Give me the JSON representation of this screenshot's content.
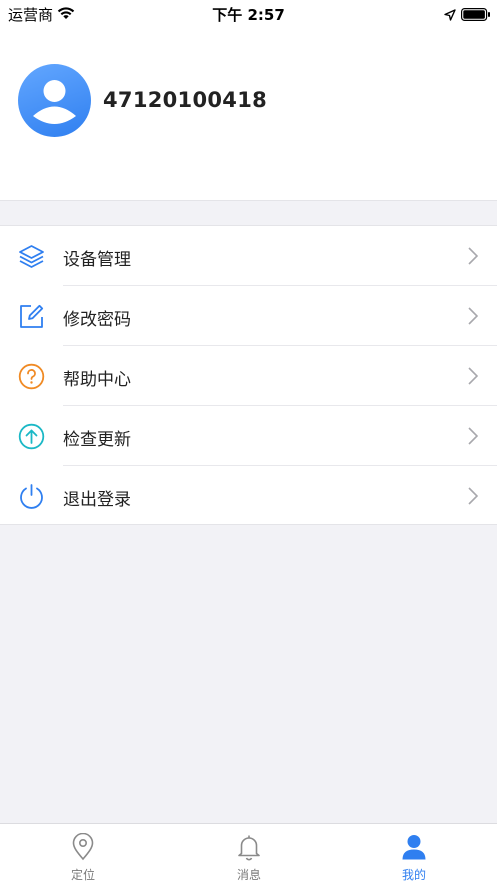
{
  "status_bar": {
    "carrier": "运营商",
    "time": "下午 2:57"
  },
  "profile": {
    "username": "47120100418"
  },
  "menu": {
    "items": [
      {
        "label": "设备管理",
        "icon": "layers-icon",
        "color": "#2f7ff0"
      },
      {
        "label": "修改密码",
        "icon": "edit-icon",
        "color": "#2f7ff0"
      },
      {
        "label": "帮助中心",
        "icon": "help-icon",
        "color": "#f08a24"
      },
      {
        "label": "检查更新",
        "icon": "upload-icon",
        "color": "#1bb8c6"
      },
      {
        "label": "退出登录",
        "icon": "power-icon",
        "color": "#2f7ff0"
      }
    ]
  },
  "tab_bar": {
    "tabs": [
      {
        "label": "定位",
        "icon": "location-pin-icon",
        "active": false
      },
      {
        "label": "消息",
        "icon": "bell-icon",
        "active": false
      },
      {
        "label": "我的",
        "icon": "person-icon",
        "active": true
      }
    ],
    "active_color": "#2f7ff0"
  }
}
